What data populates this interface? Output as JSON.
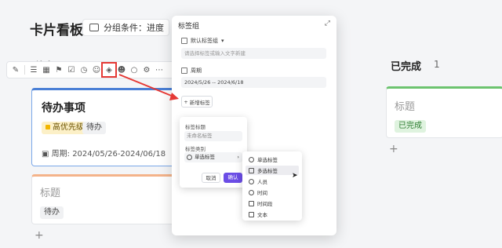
{
  "page": {
    "title": "卡片看板",
    "groupby_label": "分组条件：进度"
  },
  "board": {
    "todo_column_head": "待办",
    "done_column_head": "已完成",
    "done_count": "1",
    "card1": {
      "title": "待办事项",
      "tag_priority": "高优先级",
      "tag_status": "待办",
      "date": "周期: 2024/05/26-2024/06/18"
    },
    "card2": {
      "title": "标题",
      "tag_status": "待办"
    },
    "card3": {
      "title": "标题",
      "tag_status": "已完成"
    },
    "add_symbol": "+"
  },
  "modal": {
    "header": "标签组",
    "expand_symbol": "⤢",
    "default_group_label": "默认标签组",
    "input_placeholder": "请选择标签或输入文字新建",
    "period_label": "周期",
    "period_value": "2024/5/26 -- 2024/6/18",
    "add_tag_label": "新增标签"
  },
  "popover": {
    "name_label": "标签标题",
    "name_value": "未命名标签",
    "type_label": "标签类别",
    "type_value": "单选标签",
    "cancel_label": "取消",
    "confirm_label": "确认"
  },
  "type_menu": {
    "options": [
      "单选标签",
      "多选标签",
      "人员",
      "时间",
      "时间段",
      "文本"
    ],
    "selected_index": 1
  },
  "colors": {
    "accent": "#6b4de6",
    "highlight": "#e53935",
    "card_active_border": "#4a7fd6",
    "done_top": "#6cc36f"
  }
}
